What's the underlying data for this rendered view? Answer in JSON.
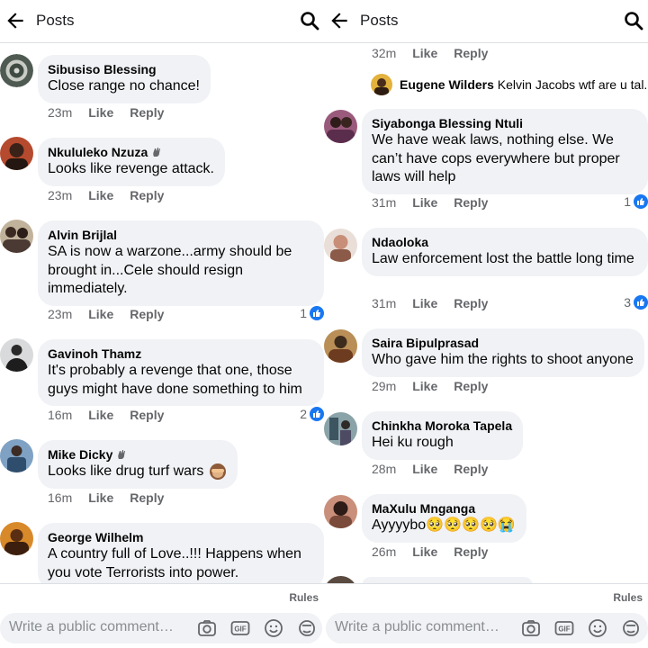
{
  "left": {
    "header": {
      "title": "Posts"
    },
    "comments": [
      {
        "author": "Sibusiso Blessing",
        "text": "Close range no chance!",
        "time": "23m",
        "like": "Like",
        "reply": "Reply",
        "reactions": ""
      },
      {
        "author": "Nkululeko Nzuza",
        "text": "Looks like revenge attack.",
        "time": "23m",
        "like": "Like",
        "reply": "Reply",
        "reactions": ""
      },
      {
        "author": "Alvin Brijlal",
        "text": "SA is now a warzone...army should be brought in...Cele should resign immediately.",
        "time": "23m",
        "like": "Like",
        "reply": "Reply",
        "reactions": "1"
      },
      {
        "author": "Gavinoh Thamz",
        "text": "It's probably a revenge that one, those guys might have done something to him",
        "time": "16m",
        "like": "Like",
        "reply": "Reply",
        "reactions": "2"
      },
      {
        "author": "Mike Dicky",
        "text": "Looks like drug turf wars",
        "time": "16m",
        "like": "Like",
        "reply": "Reply",
        "reactions": ""
      },
      {
        "author": "George Wilhelm",
        "text": "A country full of Love..!!! Happens when you vote Terrorists into power.",
        "time": "",
        "like": "",
        "reply": "",
        "reactions": ""
      }
    ],
    "footer": {
      "rules": "Rules",
      "placeholder": "Write a public comment…"
    }
  },
  "right": {
    "header": {
      "title": "Posts"
    },
    "top_meta": {
      "time": "32m",
      "like": "Like",
      "reply": "Reply"
    },
    "reply_preview": {
      "author": "Eugene Wilders",
      "text": "Kelvin Jacobs wtf are u tal..."
    },
    "comments": [
      {
        "author": "Siyabonga Blessing Ntuli",
        "text": "We have weak laws, nothing else. We can’t have cops everywhere but proper laws will help",
        "time": "31m",
        "like": "Like",
        "reply": "Reply",
        "reactions": "1"
      },
      {
        "author": "Ndaoloka",
        "text": "Law enforcement lost the battle long time",
        "time": "31m",
        "like": "Like",
        "reply": "Reply",
        "reactions": "3"
      },
      {
        "author": "Saira Bipulprasad",
        "text": "Who gave him the rights to shoot anyone",
        "time": "29m",
        "like": "Like",
        "reply": "Reply",
        "reactions": ""
      },
      {
        "author": "Chinkha Moroka Tapela",
        "text": "Hei ku rough",
        "time": "28m",
        "like": "Like",
        "reply": "Reply",
        "reactions": ""
      },
      {
        "author": "MaXulu Mnganga",
        "text": "Ayyyybo🥺🥺🥺🥺😭",
        "time": "26m",
        "like": "Like",
        "reply": "Reply",
        "reactions": ""
      }
    ],
    "footer": {
      "rules": "Rules",
      "placeholder": "Write a public comment…"
    }
  },
  "colors": {
    "accent": "#1877f2",
    "bubble": "#f0f2f5",
    "meta": "#65676b"
  },
  "icons": [
    "back-arrow-icon",
    "search-icon",
    "camera-icon",
    "gif-icon",
    "emoji-icon",
    "sticker-icon",
    "like-icon",
    "wave-badge-icon",
    "see-no-evil-monkey-emoji"
  ]
}
